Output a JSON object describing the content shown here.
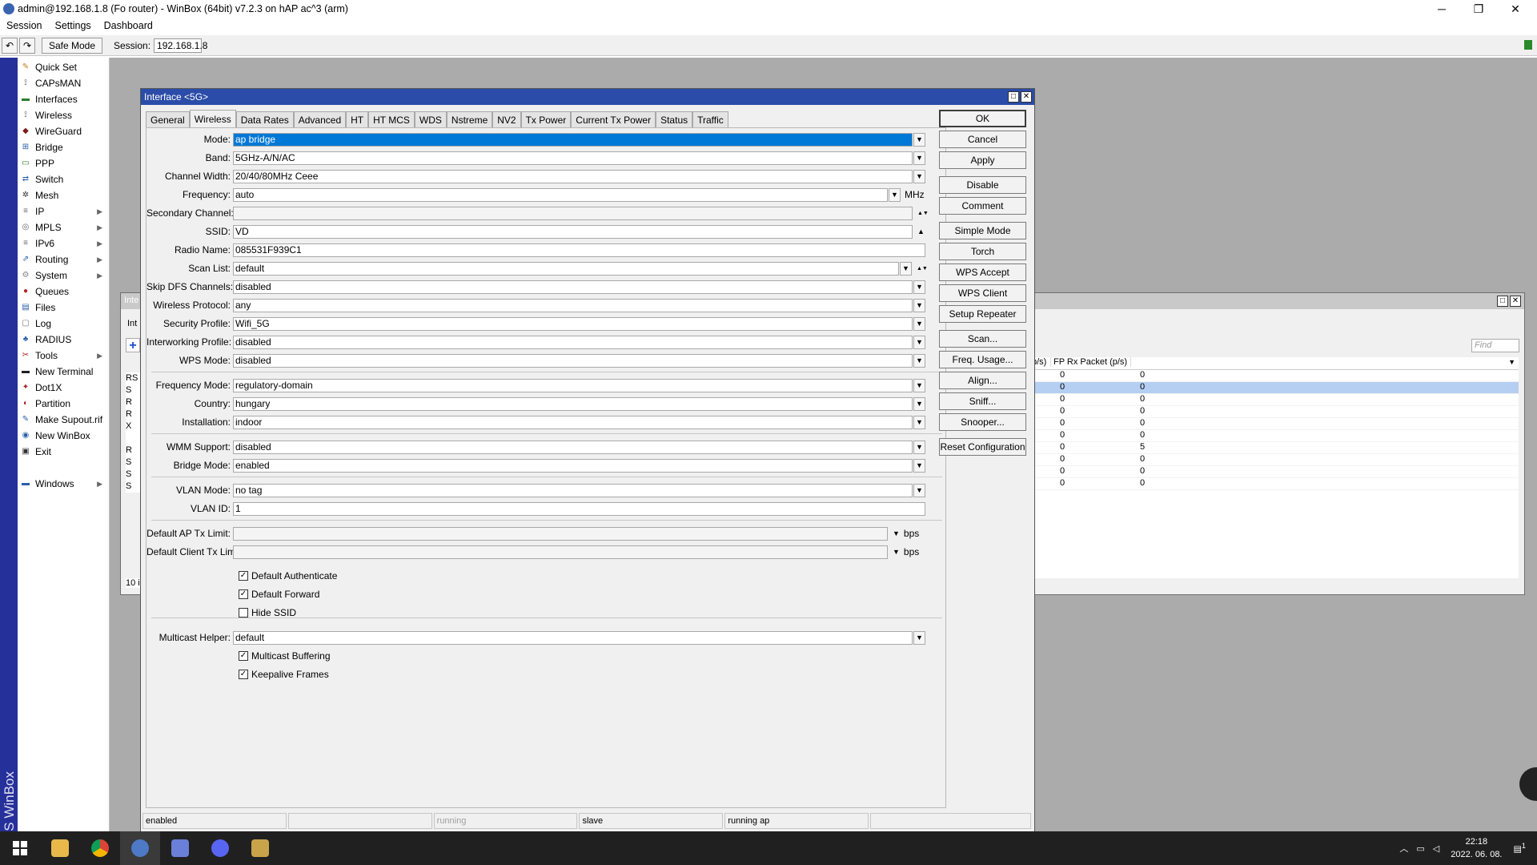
{
  "window": {
    "title": "admin@192.168.1.8 (Fo router) - WinBox (64bit) v7.2.3 on hAP ac^3 (arm)",
    "minimize": "─",
    "restore": "❐",
    "close": "✕"
  },
  "menu": [
    "Session",
    "Settings",
    "Dashboard"
  ],
  "toolbar": {
    "undo": "↶",
    "redo": "↷",
    "safe_mode": "Safe Mode",
    "session_label": "Session:",
    "session_value": "192.168.1.8"
  },
  "vertical_brand": "RouterOS WinBox",
  "sidebar": [
    {
      "label": "Quick Set",
      "icon": "✎",
      "color": "#c47c1b",
      "sub": false
    },
    {
      "label": "CAPsMAN",
      "icon": "⟟",
      "color": "#555",
      "sub": false
    },
    {
      "label": "Interfaces",
      "icon": "▬",
      "color": "#2d7d2d",
      "sub": false
    },
    {
      "label": "Wireless",
      "icon": "⟟",
      "color": "#555",
      "sub": false
    },
    {
      "label": "WireGuard",
      "icon": "◆",
      "color": "#7a1a1a",
      "sub": false
    },
    {
      "label": "Bridge",
      "icon": "⊞",
      "color": "#2a5fa8",
      "sub": false
    },
    {
      "label": "PPP",
      "icon": "▭",
      "color": "#2d7d2d",
      "sub": false
    },
    {
      "label": "Switch",
      "icon": "⇄",
      "color": "#2a5fa8",
      "sub": false
    },
    {
      "label": "Mesh",
      "icon": "✲",
      "color": "#333",
      "sub": false
    },
    {
      "label": "IP",
      "icon": "≡",
      "color": "#666",
      "sub": true
    },
    {
      "label": "MPLS",
      "icon": "◎",
      "color": "#666",
      "sub": true
    },
    {
      "label": "IPv6",
      "icon": "≡",
      "color": "#666",
      "sub": true
    },
    {
      "label": "Routing",
      "icon": "⇗",
      "color": "#2a5fa8",
      "sub": true
    },
    {
      "label": "System",
      "icon": "⚙",
      "color": "#888",
      "sub": true
    },
    {
      "label": "Queues",
      "icon": "●",
      "color": "#b22222",
      "sub": false
    },
    {
      "label": "Files",
      "icon": "▤",
      "color": "#2a5fa8",
      "sub": false
    },
    {
      "label": "Log",
      "icon": "▢",
      "color": "#777",
      "sub": false
    },
    {
      "label": "RADIUS",
      "icon": "♣",
      "color": "#2a5fa8",
      "sub": false
    },
    {
      "label": "Tools",
      "icon": "✂",
      "color": "#b22222",
      "sub": true
    },
    {
      "label": "New Terminal",
      "icon": "▬",
      "color": "#222",
      "sub": false
    },
    {
      "label": "Dot1X",
      "icon": "✦",
      "color": "#b22222",
      "sub": false
    },
    {
      "label": "Partition",
      "icon": "◐",
      "color": "#b22222",
      "sub": false
    },
    {
      "label": "Make Supout.rif",
      "icon": "✎",
      "color": "#2a5fa8",
      "sub": false
    },
    {
      "label": "New WinBox",
      "icon": "◉",
      "color": "#2a5fa8",
      "sub": false
    },
    {
      "label": "Exit",
      "icon": "▣",
      "color": "#333",
      "sub": false
    }
  ],
  "sidebar_windows": {
    "label": "Windows",
    "icon": "▬"
  },
  "bg_window": {
    "title": "Inte",
    "tab": "Int",
    "find_placeholder": "Find",
    "col1": "p/s)",
    "col2": "FP Rx Packet (p/s)",
    "footer": "10 i",
    "letters": [
      "RS",
      "S",
      "R",
      "R",
      "X",
      "",
      "R",
      "S",
      "S",
      "S"
    ],
    "rows": [
      [
        "0",
        "0"
      ],
      [
        "0",
        "0"
      ],
      [
        "0",
        "0"
      ],
      [
        "0",
        "0"
      ],
      [
        "0",
        "0"
      ],
      [
        "0",
        "0"
      ],
      [
        "0",
        "5"
      ],
      [
        "0",
        "0"
      ],
      [
        "0",
        "0"
      ],
      [
        "0",
        "0"
      ]
    ],
    "selected_row": 1
  },
  "dialog": {
    "title": "Interface <5G>",
    "tabs": [
      "General",
      "Wireless",
      "Data Rates",
      "Advanced",
      "HT",
      "HT MCS",
      "WDS",
      "Nstreme",
      "NV2",
      "Tx Power",
      "Current Tx Power",
      "Status",
      "Traffic"
    ],
    "active_tab": "Wireless",
    "fields": {
      "mode": {
        "label": "Mode:",
        "value": "ap bridge"
      },
      "band": {
        "label": "Band:",
        "value": "5GHz-A/N/AC"
      },
      "channel_width": {
        "label": "Channel Width:",
        "value": "20/40/80MHz Ceee"
      },
      "frequency": {
        "label": "Frequency:",
        "value": "auto",
        "unit": "MHz"
      },
      "secondary_channel": {
        "label": "Secondary Channel:",
        "value": ""
      },
      "ssid": {
        "label": "SSID:",
        "value": "VD"
      },
      "radio_name": {
        "label": "Radio Name:",
        "value": "085531F939C1"
      },
      "scan_list": {
        "label": "Scan List:",
        "value": "default"
      },
      "skip_dfs": {
        "label": "Skip DFS Channels:",
        "value": "disabled"
      },
      "wireless_protocol": {
        "label": "Wireless Protocol:",
        "value": "any"
      },
      "security_profile": {
        "label": "Security Profile:",
        "value": "Wifi_5G"
      },
      "interworking_profile": {
        "label": "Interworking Profile:",
        "value": "disabled"
      },
      "wps_mode": {
        "label": "WPS Mode:",
        "value": "disabled"
      },
      "frequency_mode": {
        "label": "Frequency Mode:",
        "value": "regulatory-domain"
      },
      "country": {
        "label": "Country:",
        "value": "hungary"
      },
      "installation": {
        "label": "Installation:",
        "value": "indoor"
      },
      "wmm_support": {
        "label": "WMM Support:",
        "value": "disabled"
      },
      "bridge_mode": {
        "label": "Bridge Mode:",
        "value": "enabled"
      },
      "vlan_mode": {
        "label": "VLAN Mode:",
        "value": "no tag"
      },
      "vlan_id": {
        "label": "VLAN ID:",
        "value": "1"
      },
      "ap_tx_limit": {
        "label": "Default AP Tx Limit:",
        "value": "",
        "unit": "bps"
      },
      "client_tx_limit": {
        "label": "Default Client Tx Limit:",
        "value": "",
        "unit": "bps"
      },
      "multicast_helper": {
        "label": "Multicast Helper:",
        "value": "default"
      }
    },
    "checkboxes": {
      "default_authenticate": {
        "label": "Default Authenticate",
        "checked": true
      },
      "default_forward": {
        "label": "Default Forward",
        "checked": true
      },
      "hide_ssid": {
        "label": "Hide SSID",
        "checked": false
      },
      "multicast_buffering": {
        "label": "Multicast Buffering",
        "checked": true
      },
      "keepalive_frames": {
        "label": "Keepalive Frames",
        "checked": true
      }
    },
    "buttons": [
      "OK",
      "Cancel",
      "Apply",
      "Disable",
      "Comment",
      "Simple Mode",
      "Torch",
      "WPS Accept",
      "WPS Client",
      "Setup Repeater",
      "Scan...",
      "Freq. Usage...",
      "Align...",
      "Sniff...",
      "Snooper...",
      "Reset Configuration"
    ],
    "status": [
      "enabled",
      "",
      "running",
      "slave",
      "running ap",
      ""
    ]
  },
  "taskbar": {
    "time": "22:18",
    "date": "2022. 06. 08.",
    "notif": "1"
  }
}
